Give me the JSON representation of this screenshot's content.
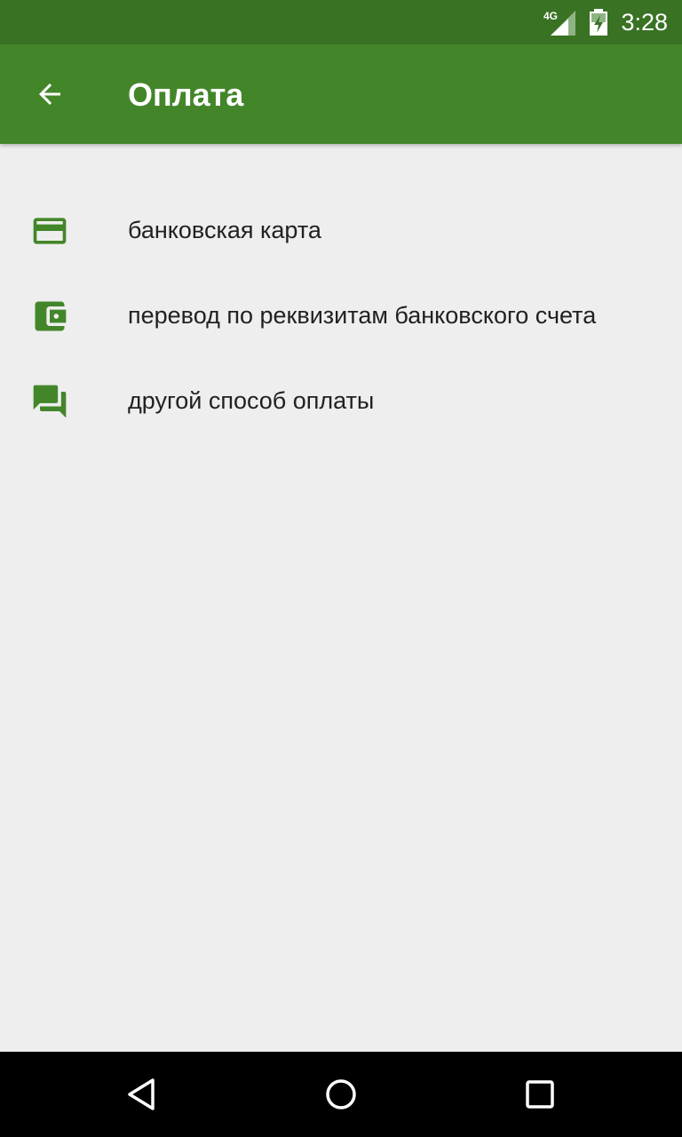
{
  "status_bar": {
    "network": "4G",
    "time": "3:28"
  },
  "app_bar": {
    "title": "Оплата",
    "back_icon": "arrow-back-icon"
  },
  "payment_methods": [
    {
      "label": "банковская карта",
      "icon": "credit-card-icon"
    },
    {
      "label": "перевод по реквизитам банковского счета",
      "icon": "wallet-icon"
    },
    {
      "label": "другой способ оплаты",
      "icon": "chat-bubbles-icon"
    }
  ],
  "nav_bar": {
    "back": "nav-back-icon",
    "home": "nav-home-icon",
    "recents": "nav-recents-icon"
  },
  "colors": {
    "status_bar": "#3a7224",
    "app_bar": "#43862a",
    "icon": "#43862a",
    "background": "#eeeeee"
  }
}
